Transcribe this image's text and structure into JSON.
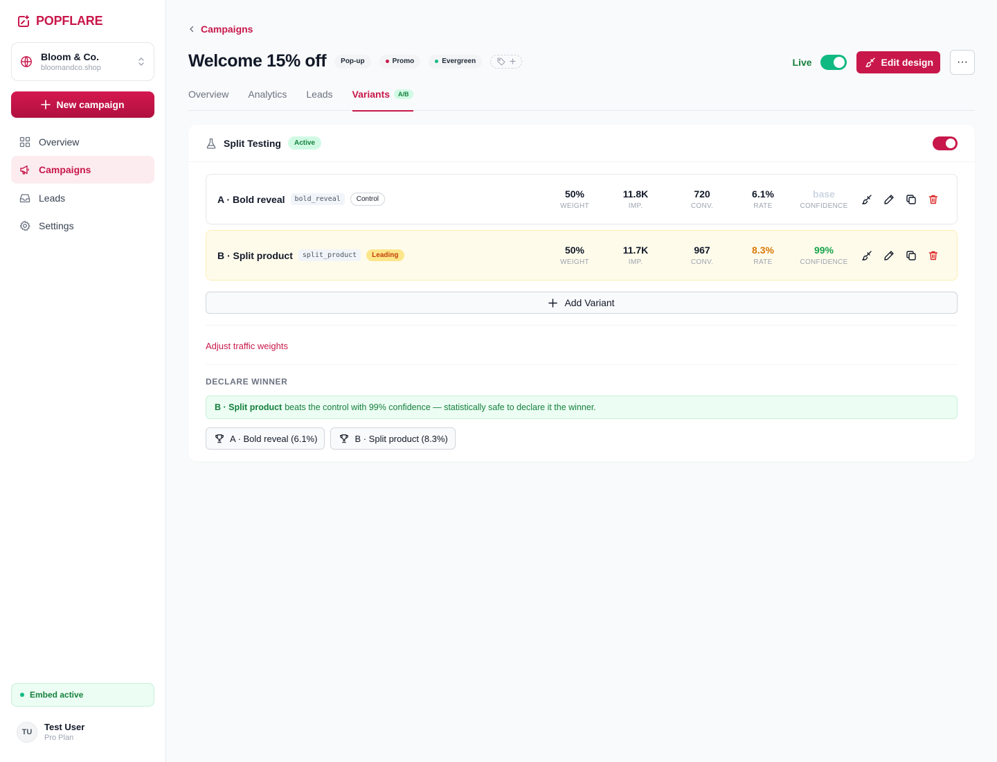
{
  "brand": {
    "name": "POPFLARE",
    "accent": "#c8174a"
  },
  "store": {
    "name": "Bloom & Co.",
    "url": "bloomandco.shop"
  },
  "sidebar": {
    "new_campaign_label": "New campaign",
    "items": [
      {
        "label": "Overview",
        "icon": "grid-icon"
      },
      {
        "label": "Campaigns",
        "icon": "megaphone-icon",
        "active": true
      },
      {
        "label": "Leads",
        "icon": "inbox-icon"
      },
      {
        "label": "Settings",
        "icon": "gear-icon"
      }
    ],
    "embed_status": "Embed active",
    "user": {
      "initials": "TU",
      "name": "Test User",
      "plan": "Pro Plan"
    }
  },
  "header": {
    "breadcrumb": "Campaigns",
    "title": "Welcome 15% off",
    "chips": [
      {
        "label": "Pop-up"
      },
      {
        "label": "Promo",
        "dot_color": "#c8174a"
      },
      {
        "label": "Evergreen",
        "dot_color": "#10b981"
      }
    ],
    "live_label": "Live",
    "live_on": true,
    "edit_label": "Edit design",
    "more_label": "···"
  },
  "tabs": [
    {
      "label": "Overview"
    },
    {
      "label": "Analytics"
    },
    {
      "label": "Leads"
    },
    {
      "label": "Variants",
      "badge": "A/B",
      "active": true
    }
  ],
  "split_testing": {
    "title": "Split Testing",
    "status": "Active",
    "enabled": true,
    "stat_labels": [
      "WEIGHT",
      "IMP.",
      "CONV.",
      "RATE",
      "CONFIDENCE"
    ],
    "variants": [
      {
        "name": "A · Bold reveal",
        "code": "bold_reveal",
        "tag": "Control",
        "weight": "50%",
        "impressions": "11.8K",
        "conversions": "720",
        "rate": "6.1%",
        "confidence": "base"
      },
      {
        "name": "B · Split product",
        "code": "split_product",
        "tag": "Leading",
        "weight": "50%",
        "impressions": "11.7K",
        "conversions": "967",
        "rate": "8.3%",
        "confidence": "99%"
      }
    ],
    "add_variant_label": "Add Variant",
    "adjust_weights_label": "Adjust traffic weights",
    "declare": {
      "title": "DECLARE WINNER",
      "note_strong": "B · Split product",
      "note_rest": "beats the control with 99% confidence — statistically safe to declare it the winner.",
      "buttons": [
        "A · Bold reveal (6.1%)",
        "B · Split product (8.3%)"
      ]
    }
  }
}
